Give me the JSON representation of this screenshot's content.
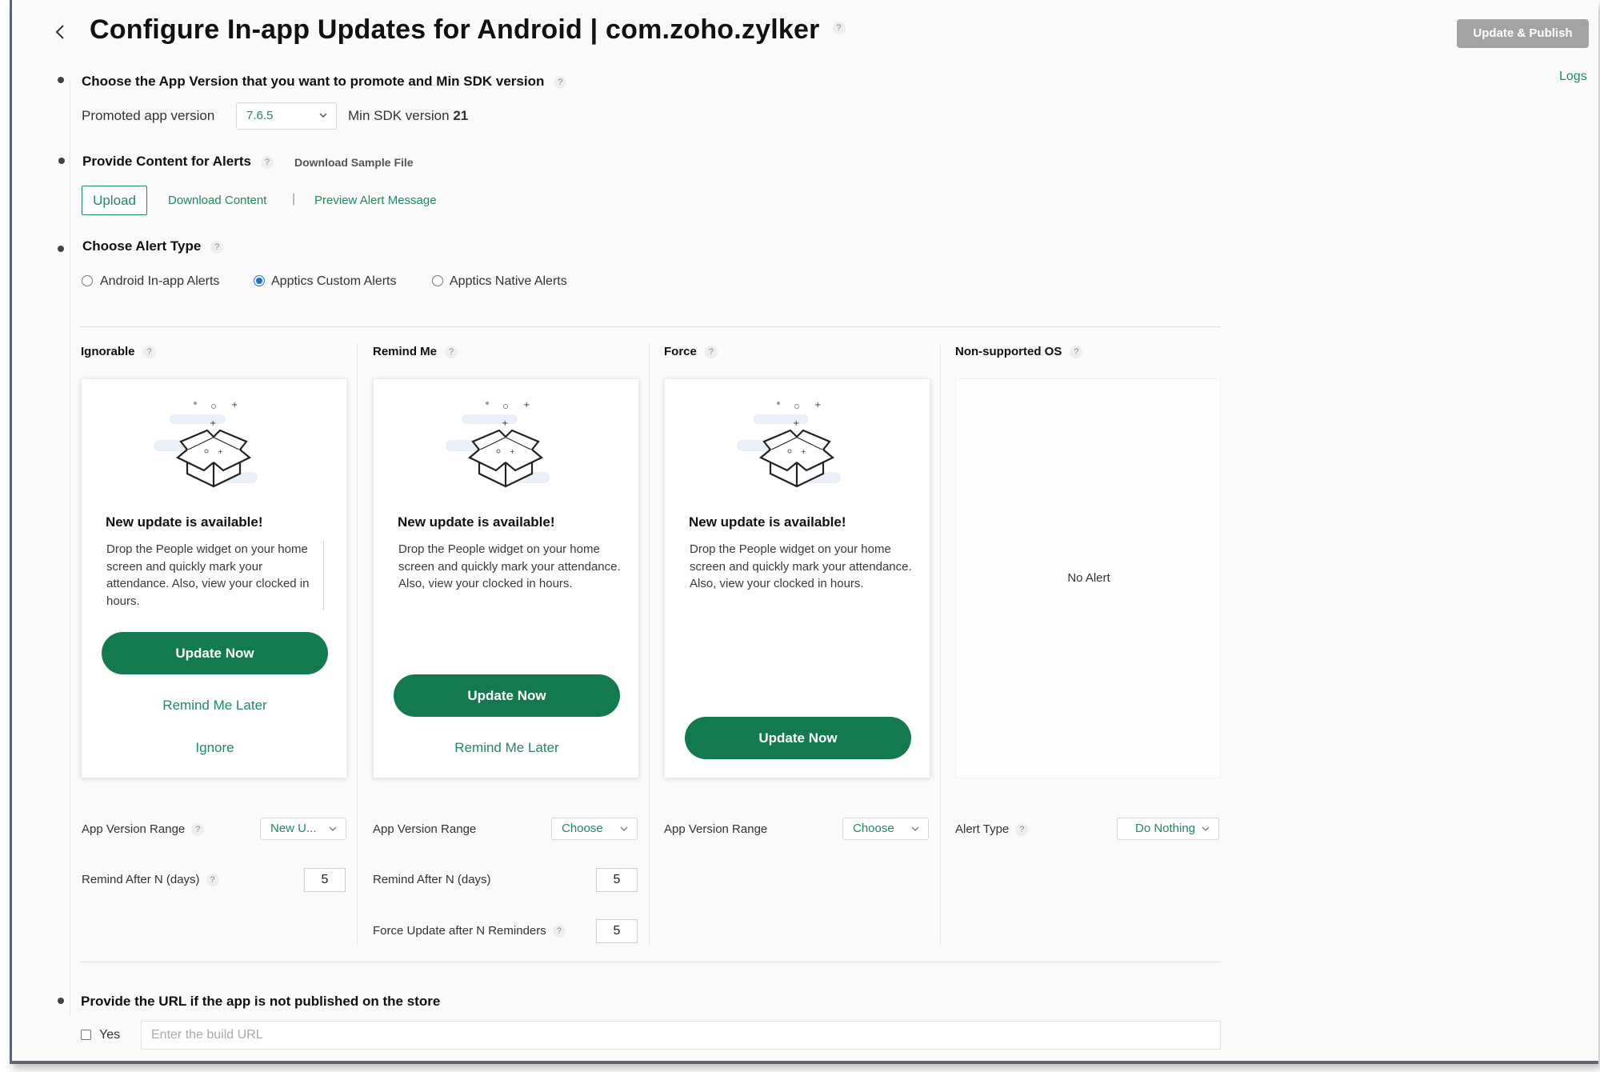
{
  "header": {
    "title": "Configure In-app Updates for Android | com.zoho.zylker",
    "publish_label": "Update & Publish",
    "logs_label": "Logs"
  },
  "help_mark": "?",
  "step1": {
    "title": "Choose the App Version that you want to promote and Min SDK version",
    "promoted_label": "Promoted app version",
    "promoted_value": "7.6.5",
    "min_sdk_label": "Min SDK version",
    "min_sdk_value": "21"
  },
  "step2": {
    "title": "Provide Content for Alerts",
    "sample_label": "Download Sample File",
    "upload_label": "Upload",
    "download_content_label": "Download Content",
    "separator": "|",
    "preview_label": "Preview Alert Message"
  },
  "step3": {
    "title": "Choose Alert Type",
    "options": [
      "Android In-app Alerts",
      "Apptics Custom Alerts",
      "Apptics Native Alerts"
    ],
    "selected": "Apptics Custom Alerts"
  },
  "columns": {
    "ignorable": {
      "heading": "Ignorable",
      "card_title": "New update is available!",
      "card_body": "Drop the People widget on your home screen and quickly mark your attendance. Also, view your clocked in hours.",
      "update_label": "Update Now",
      "remind_label": "Remind Me Later",
      "ignore_label": "Ignore",
      "range_label": "App Version Range",
      "range_value": "New U...",
      "remind_after_label": "Remind After N (days)",
      "remind_after_value": "5"
    },
    "remind_me": {
      "heading": "Remind Me",
      "card_title": "New update is available!",
      "card_body": "Drop the People widget on your home screen and quickly mark your attendance. Also, view your clocked in hours.",
      "update_label": "Update Now",
      "remind_label": "Remind Me Later",
      "range_label": "App Version Range",
      "range_value": "Choose",
      "remind_after_label": "Remind After N (days)",
      "remind_after_value": "5",
      "force_after_label": "Force Update after N Reminders",
      "force_after_value": "5"
    },
    "force": {
      "heading": "Force",
      "card_title": "New update is available!",
      "card_body": "Drop the People widget on your home screen and quickly mark your attendance. Also, view your clocked in hours.",
      "update_label": "Update Now",
      "range_label": "App Version Range",
      "range_value": "Choose"
    },
    "non_supported": {
      "heading": "Non-supported OS",
      "no_alert": "No Alert",
      "alert_type_label": "Alert Type",
      "alert_type_value": "Do Nothing"
    }
  },
  "step4": {
    "title": "Provide the URL if the app is not published on the store",
    "yes_label": "Yes",
    "url_placeholder": "Enter the build URL"
  },
  "icons": {
    "back": "chevron-left-icon",
    "dropdown": "chevron-down-icon",
    "help": "question-icon",
    "illustration": "open-box-illustration"
  },
  "colors": {
    "accent": "#1f8a5c",
    "button": "#137a50",
    "publish_disabled": "#a3a3a3",
    "radio_selected": "#1e6fd9"
  }
}
